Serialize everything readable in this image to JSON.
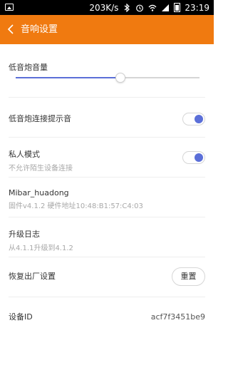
{
  "status_bar": {
    "speed": "203K/s",
    "time": "23:19",
    "icons": [
      "image-icon",
      "bluetooth-icon",
      "alarm-icon",
      "wifi-icon",
      "signal-icon",
      "battery-icon"
    ]
  },
  "header": {
    "title": "音响设置",
    "accent_color": "#f07a10"
  },
  "settings": {
    "subwoofer_volume": {
      "label": "低音炮音量",
      "level": 0.57
    },
    "connect_tone": {
      "label": "低音炮连接提示音",
      "enabled": true
    },
    "private_mode": {
      "label": "私人模式",
      "description": "不允许陌生设备连接",
      "enabled": true
    },
    "device_info": {
      "name": "Mibar_huadong",
      "detail": "固件v4.1.2  硬件地址10:48:B1:57:C4:03"
    },
    "upgrade_log": {
      "label": "升级日志",
      "detail": "从4.1.1升级到4.1.2"
    },
    "factory_reset": {
      "label": "恢复出厂设置",
      "button": "重置"
    },
    "device_id": {
      "label": "设备ID",
      "value": "acf7f3451be9"
    }
  },
  "colors": {
    "toggle_on": "#5b6fd8",
    "slider_fill": "#5b6fd8"
  }
}
